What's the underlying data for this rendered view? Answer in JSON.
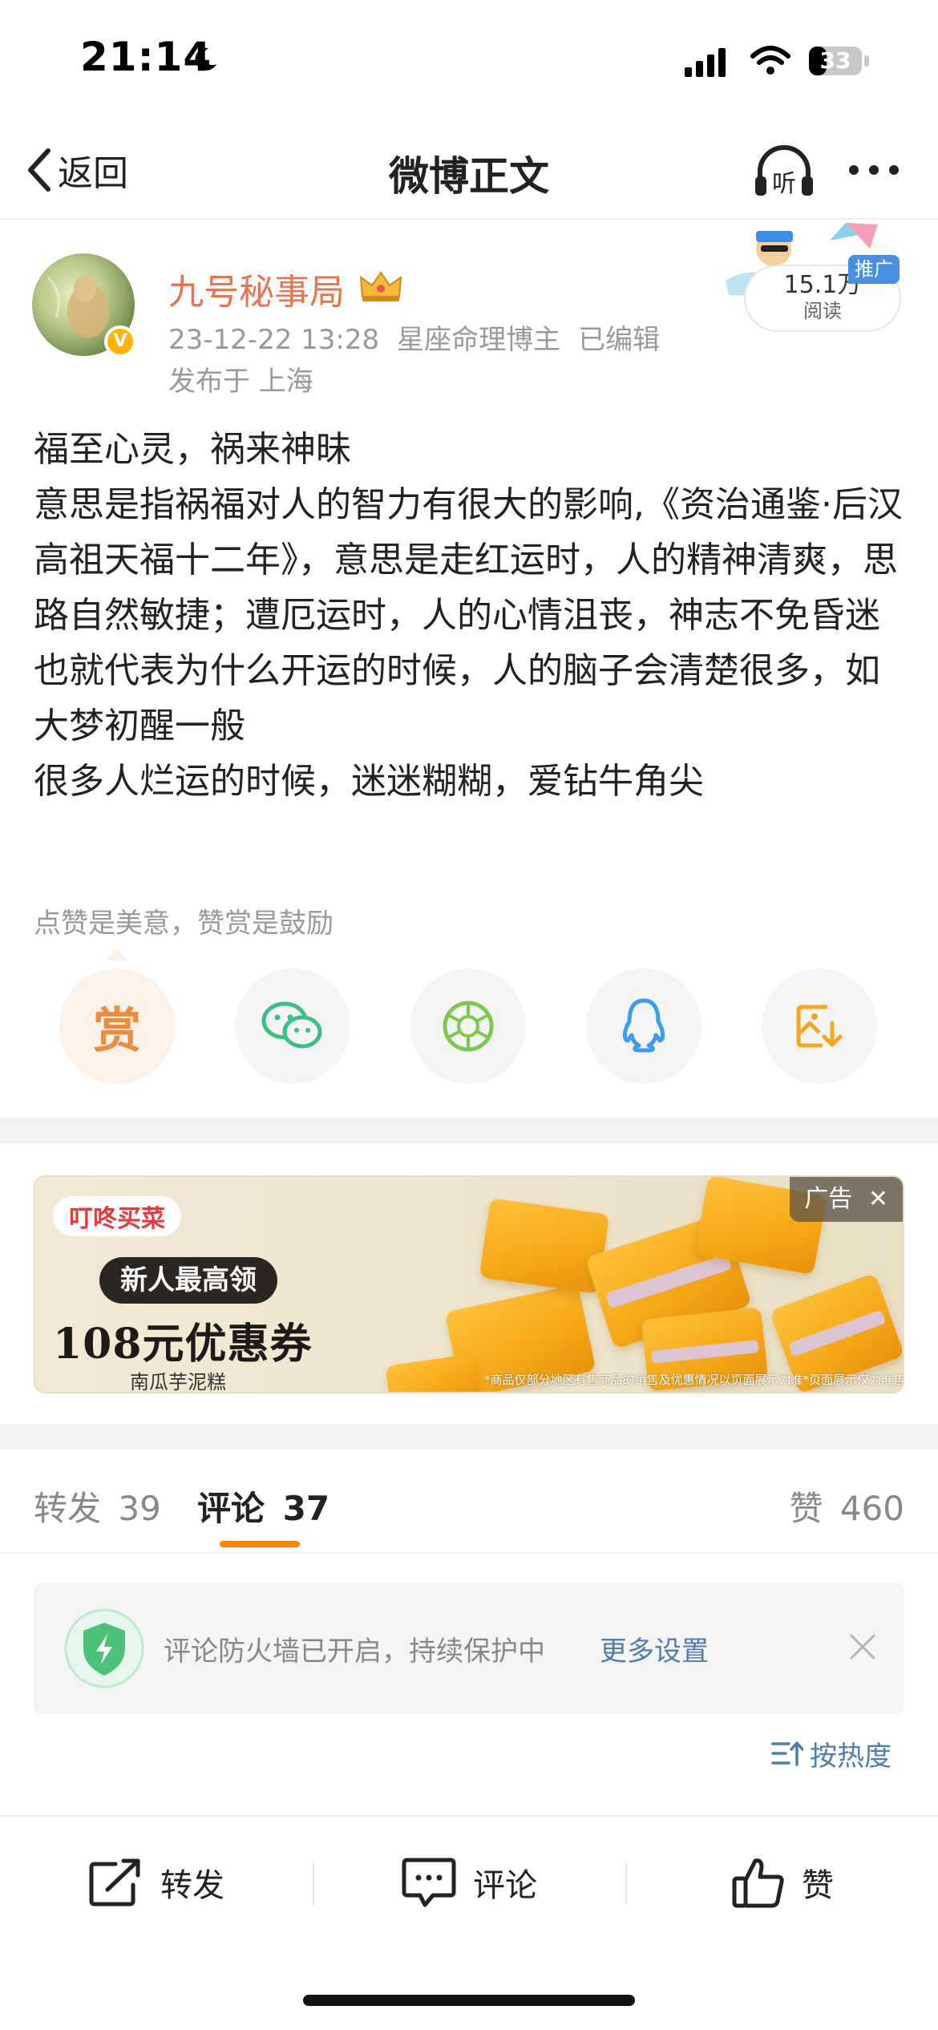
{
  "status_bar": {
    "time": "21:14",
    "battery": "33"
  },
  "nav": {
    "back_label": "返回",
    "title": "微博正文",
    "listen_label": "听"
  },
  "author": {
    "name": "九号秘事局",
    "date": "23-12-22 13:28",
    "tag": "星座命理博主",
    "edited": "已编辑",
    "location": "发布于 上海"
  },
  "stats_badge": {
    "reads": "15.1万",
    "reads_label": "阅读",
    "promo": "推广"
  },
  "post": {
    "lines": [
      "福至心灵，祸来神昧",
      "意思是指祸福对人的智力有很大的影响,《资治通鉴·后汉高祖天福十二年》，意思是走红运时，人的精神清爽，思路自然敏捷；遭厄运时，人的心情沮丧，神志不免昏迷",
      "也就代表为什么开运的时候，人的脑子会清楚很多，如大梦初醒一般",
      "很多人烂运的时候，迷迷糊糊，爱钻牛角尖"
    ]
  },
  "support_tip": "点赞是美意，赞赏是鼓励",
  "share": {
    "reward_label": "赏",
    "items": [
      "reward-icon",
      "wechat-icon",
      "moments-icon",
      "qq-icon",
      "save-image-icon"
    ]
  },
  "ad": {
    "brand": "叮咚买菜",
    "pill": "新人最高领",
    "headline": "108元优惠券",
    "sub": "南瓜芋泥糕",
    "label": "广告",
    "disclaimer": "*商品仅部分地区有售商品的销售及优惠情况以页面展示为准*页面展示仅为准售完即止"
  },
  "tabs": {
    "repost_label": "转发",
    "repost_count": "39",
    "comment_label": "评论",
    "comment_count": "37",
    "like_label": "赞",
    "like_count": "460"
  },
  "firewall": {
    "text": "评论防火墙已开启，持续保护中",
    "link": "更多设置"
  },
  "sort_label": "按热度",
  "bottom_bar": {
    "repost": "转发",
    "comment": "评论",
    "like": "赞"
  },
  "colors": {
    "accent": "#ff8200",
    "username": "#eb7350",
    "link": "#507daf"
  }
}
